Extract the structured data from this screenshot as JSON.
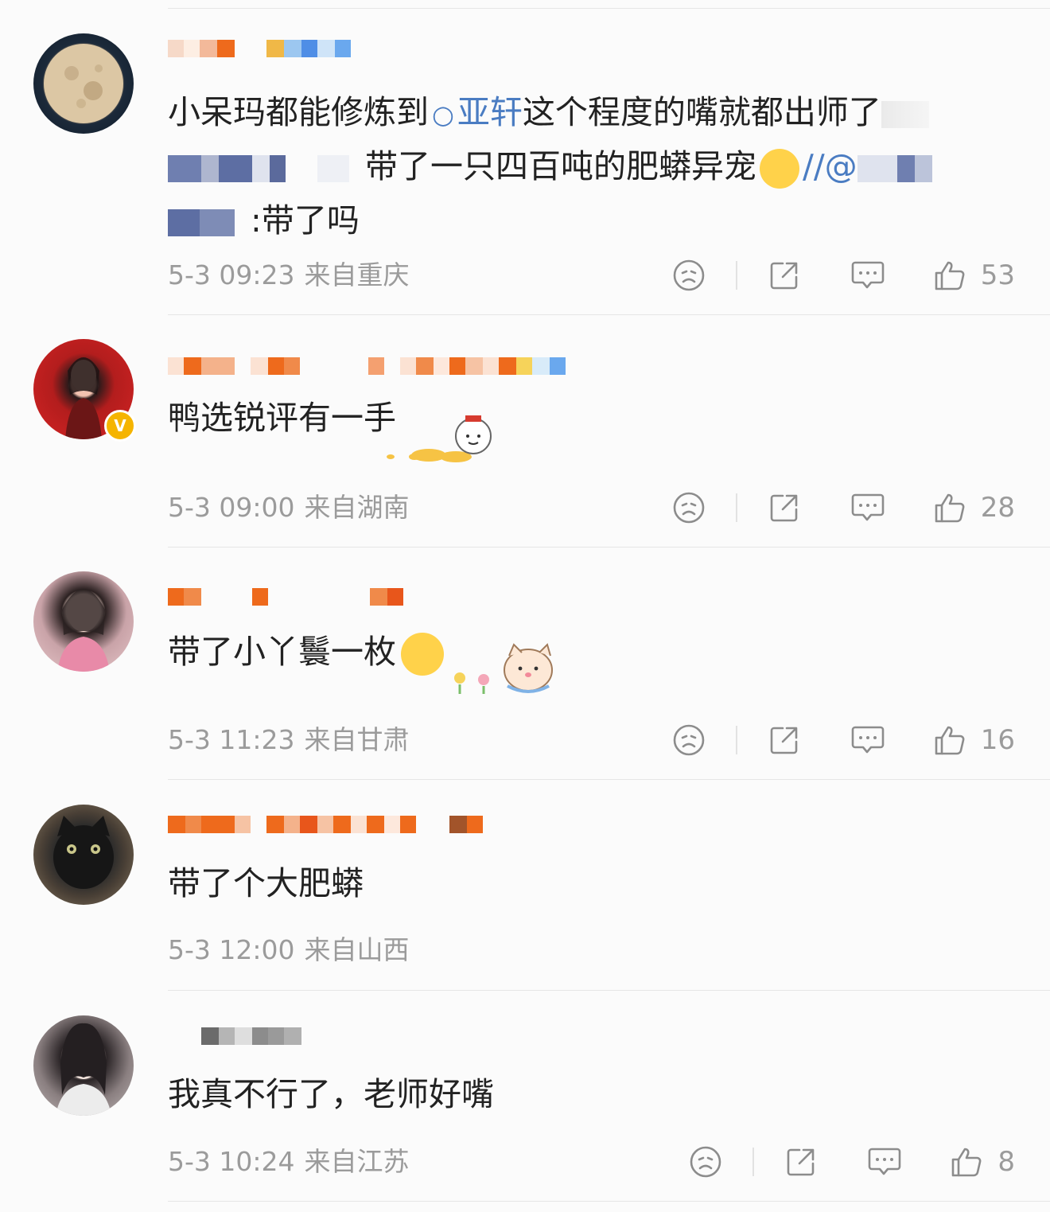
{
  "comments": [
    {
      "text_part1": "小呆玛都能修炼到",
      "mention_topic": "亚轩",
      "text_part2": "这个程度的嘴就都出师了",
      "text_line2": "带了一只四百吨的肥蟒异宠",
      "text_line2_suffix": "//@",
      "text_line3": ":带了吗",
      "time": "5-3 09:23",
      "location": "来自重庆",
      "likes": "53"
    },
    {
      "text": "鸭选锐评有一手",
      "time": "5-3 09:00",
      "location": "来自湖南",
      "likes": "28"
    },
    {
      "text": "带了小丫鬟一枚",
      "time": "5-3 11:23",
      "location": "来自甘肃",
      "likes": "16"
    },
    {
      "text": "带了个大肥蟒",
      "time": "5-3 12:00",
      "location": "来自山西"
    },
    {
      "text": "我真不行了，老师好嘴",
      "time": "5-3 10:24",
      "location": "来自江苏",
      "likes": "8"
    }
  ],
  "icons": {
    "dislike": "sad-face-icon",
    "share": "share-icon",
    "reply": "comment-icon",
    "like": "thumbs-up-icon",
    "verified": "v-badge-icon"
  },
  "colors": {
    "mention": "#4a7cc2",
    "meta": "#9b9b9b",
    "name_orange": "#ee6a1c",
    "verified": "#f5b400"
  }
}
